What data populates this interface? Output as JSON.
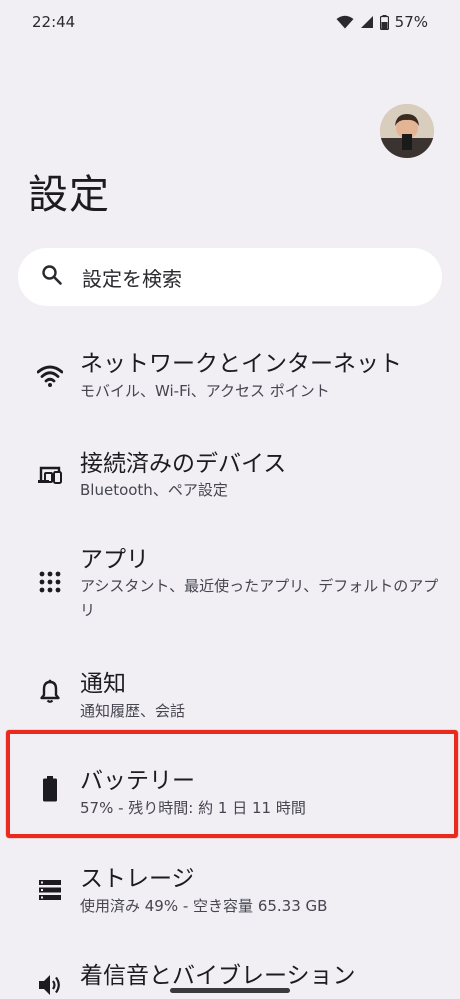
{
  "status_bar": {
    "time": "22:44",
    "battery_percent": "57%",
    "icons": [
      "wifi-icon",
      "signal-icon",
      "battery-icon"
    ]
  },
  "header": {
    "title": "設定"
  },
  "search": {
    "placeholder": "設定を検索"
  },
  "items": [
    {
      "icon": "wifi-icon",
      "title": "ネットワークとインターネット",
      "subtitle": "モバイル、Wi-Fi、アクセス ポイント"
    },
    {
      "icon": "connected-devices-icon",
      "title": "接続済みのデバイス",
      "subtitle": "Bluetooth、ペア設定"
    },
    {
      "icon": "apps-grid-icon",
      "title": "アプリ",
      "subtitle": "アシスタント、最近使ったアプリ、デフォルトのアプリ"
    },
    {
      "icon": "bell-icon",
      "title": "通知",
      "subtitle": "通知履歴、会話"
    },
    {
      "icon": "battery-icon",
      "title": "バッテリー",
      "subtitle": "57% - 残り時間: 約 1 日 11 時間"
    },
    {
      "icon": "storage-icon",
      "title": "ストレージ",
      "subtitle": "使用済み 49% - 空き容量 65.33 GB"
    },
    {
      "icon": "volume-icon",
      "title": "着信音とバイブレーション",
      "subtitle": ""
    }
  ],
  "colors": {
    "background": "#f1eff4",
    "highlight_border": "#ea2a1c"
  }
}
